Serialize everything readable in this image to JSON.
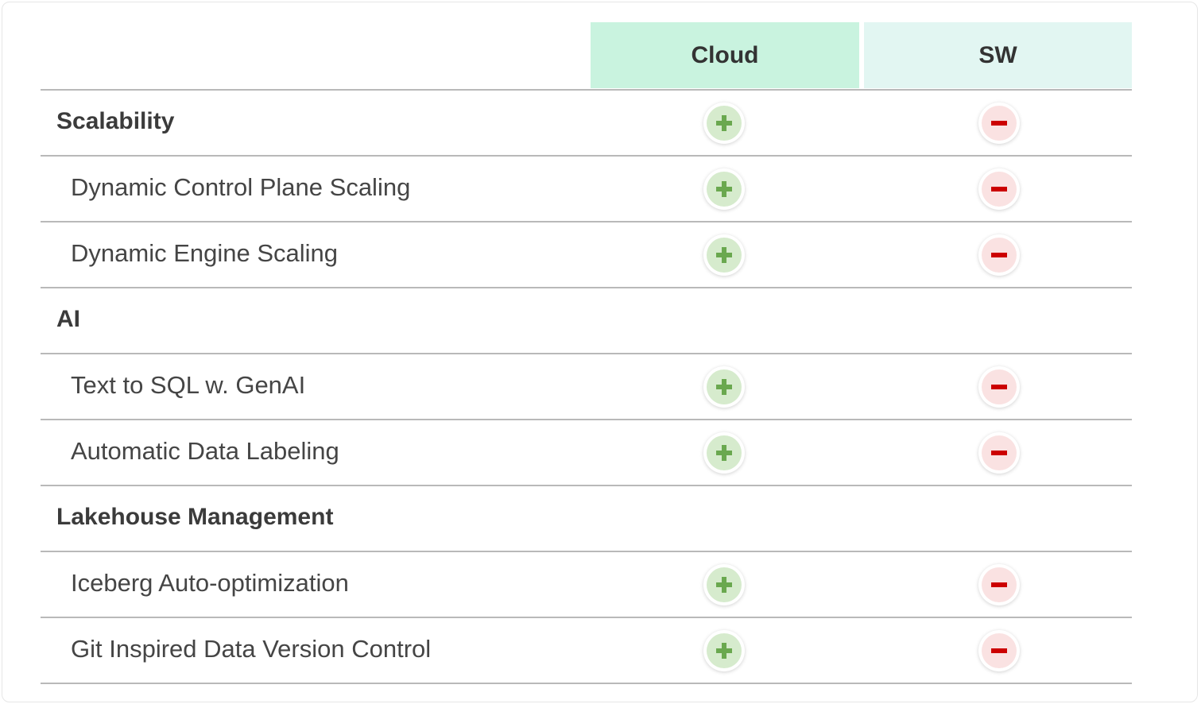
{
  "header": {
    "cloud_label": "Cloud",
    "sw_label": "SW"
  },
  "colors": {
    "cloud_header_bg": "#c9f3df",
    "sw_header_bg": "#e2f6f2",
    "plus_green": "#6aa84f",
    "minus_red": "#cc0000"
  },
  "rows": [
    {
      "type": "section",
      "label": "Scalability",
      "cloud": "plus-icon",
      "sw": "minus-icon"
    },
    {
      "type": "feature",
      "label": "Dynamic Control Plane Scaling",
      "cloud": "plus-icon",
      "sw": "minus-icon"
    },
    {
      "type": "feature",
      "label": "Dynamic Engine Scaling",
      "cloud": "plus-icon",
      "sw": "minus-icon"
    },
    {
      "type": "section",
      "label": "AI"
    },
    {
      "type": "feature",
      "label": "Text to SQL w. GenAI",
      "cloud": "plus-icon",
      "sw": "minus-icon"
    },
    {
      "type": "feature",
      "label": "Automatic Data Labeling",
      "cloud": "plus-icon",
      "sw": "minus-icon"
    },
    {
      "type": "section",
      "label": "Lakehouse Management"
    },
    {
      "type": "feature",
      "label": "Iceberg Auto-optimization",
      "cloud": "plus-icon",
      "sw": "minus-icon"
    },
    {
      "type": "feature",
      "label": "Git Inspired Data Version Control",
      "cloud": "plus-icon",
      "sw": "minus-icon"
    }
  ]
}
